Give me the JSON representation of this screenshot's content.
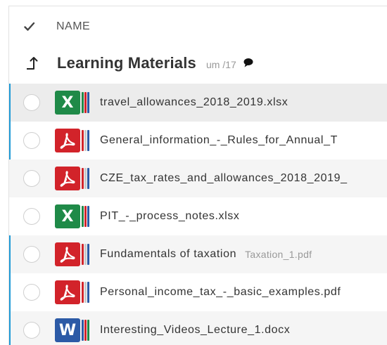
{
  "header": {
    "column_name": "NAME"
  },
  "folder": {
    "title": "Learning Materials",
    "count": "um /17"
  },
  "files": [
    {
      "name": "travel_allowances_2018_2019.xlsx",
      "type": "xlsx",
      "icon": "excel-icon",
      "sub": "",
      "accent": true,
      "shade": "selected"
    },
    {
      "name": "General_information_-_Rules_for_Annual_T",
      "type": "pdf",
      "icon": "pdf-icon",
      "sub": "",
      "accent": true,
      "shade": "white"
    },
    {
      "name": "CZE_tax_rates_and_allowances_2018_2019_",
      "type": "pdf",
      "icon": "pdf-icon",
      "sub": "",
      "accent": false,
      "shade": "alt"
    },
    {
      "name": "PIT_-_process_notes.xlsx",
      "type": "xlsx",
      "icon": "excel-icon",
      "sub": "",
      "accent": false,
      "shade": "white"
    },
    {
      "name": "Fundamentals of taxation",
      "type": "pdf",
      "icon": "pdf-icon",
      "sub": "Taxation_1.pdf",
      "accent": true,
      "shade": "alt"
    },
    {
      "name": "Personal_income_tax_-_basic_examples.pdf",
      "type": "pdf",
      "icon": "pdf-icon",
      "sub": "",
      "accent": true,
      "shade": "white"
    },
    {
      "name": "Interesting_Videos_Lecture_1.docx",
      "type": "docx",
      "icon": "word-icon",
      "sub": "",
      "accent": true,
      "shade": "alt"
    }
  ],
  "colors": {
    "accent": "#1e9ad6",
    "excel": "#1f8a48",
    "pdf": "#d2232a",
    "word": "#2c5aa6"
  }
}
